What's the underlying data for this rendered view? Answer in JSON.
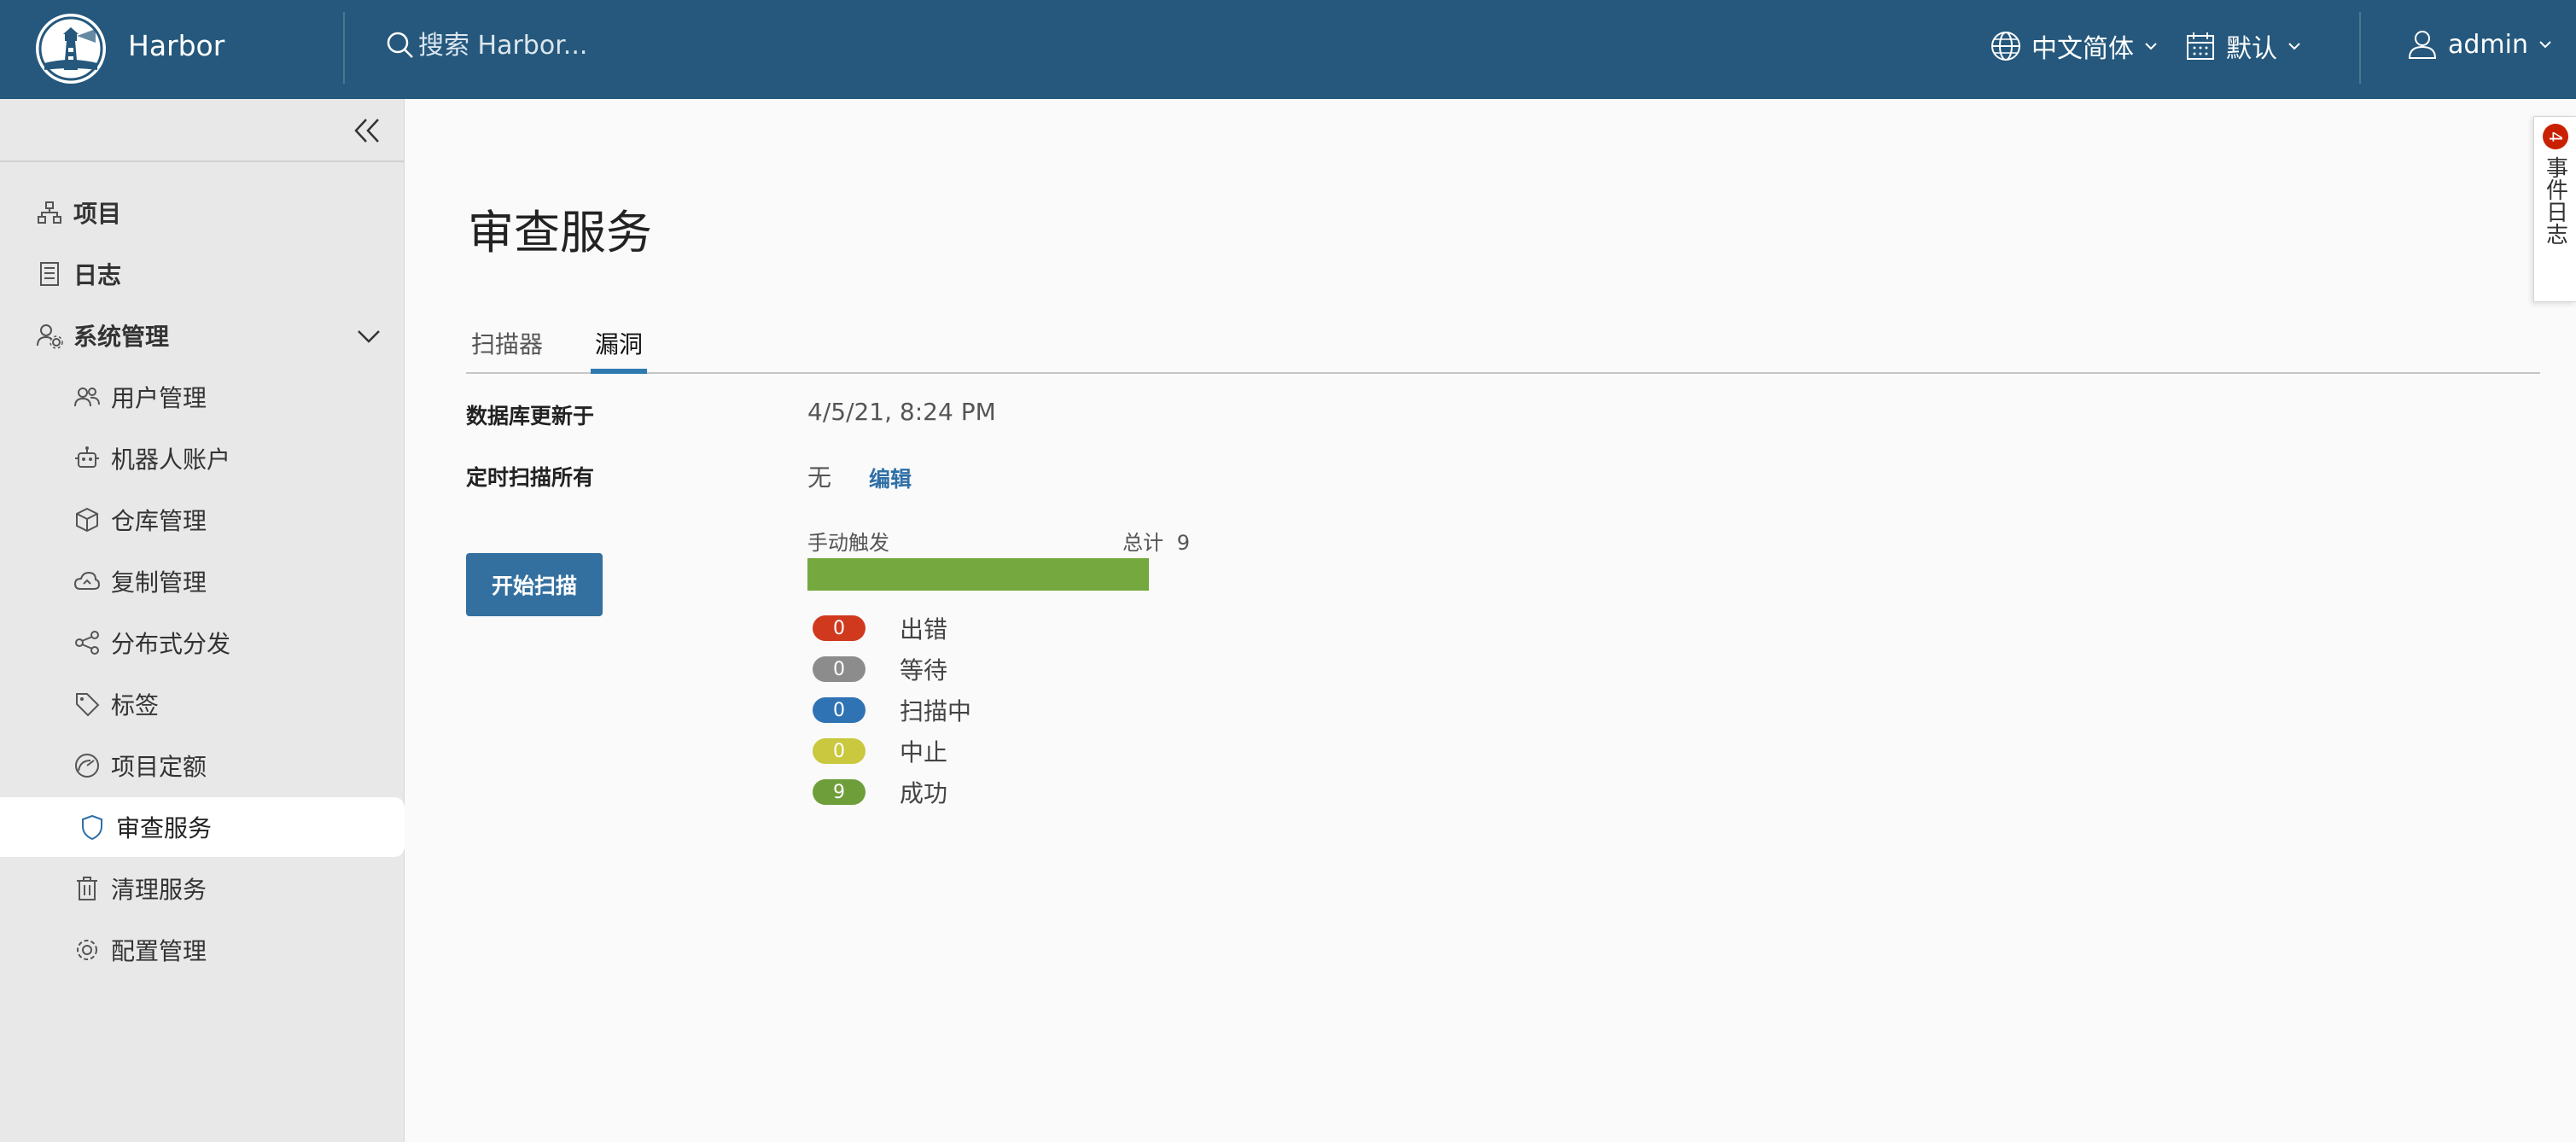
{
  "header": {
    "brand": "Harbor",
    "search_placeholder": "搜索 Harbor...",
    "language": "中文简体",
    "date_format": "默认",
    "user": "admin"
  },
  "sidebar": {
    "projects": "项目",
    "logs": "日志",
    "admin": "系统管理",
    "sub_items": [
      "用户管理",
      "机器人账户",
      "仓库管理",
      "复制管理",
      "分布式分发",
      "标签",
      "项目定额",
      "审查服务",
      "清理服务",
      "配置管理"
    ]
  },
  "main": {
    "title": "审查服务",
    "tabs": [
      "扫描器",
      "漏洞"
    ],
    "db_updated_label": "数据库更新于",
    "db_updated_value": "4/5/21, 8:24 PM",
    "schedule_label": "定时扫描所有",
    "schedule_value": "无",
    "edit_label": "编辑",
    "scan_button": "开始扫描",
    "trigger_label": "手动触发",
    "total_label": "总计",
    "total_value": "9",
    "progress_fraction": 1.0,
    "statuses": [
      {
        "count": "0",
        "label": "出错",
        "color": "#d0391e"
      },
      {
        "count": "0",
        "label": "等待",
        "color": "#8c8c8c"
      },
      {
        "count": "0",
        "label": "扫描中",
        "color": "#2f73b4"
      },
      {
        "count": "0",
        "label": "中止",
        "color": "#c9c83e"
      },
      {
        "count": "9",
        "label": "成功",
        "color": "#6e9e3a"
      }
    ]
  },
  "event_log": {
    "label": "事件日志",
    "count": "4"
  }
}
